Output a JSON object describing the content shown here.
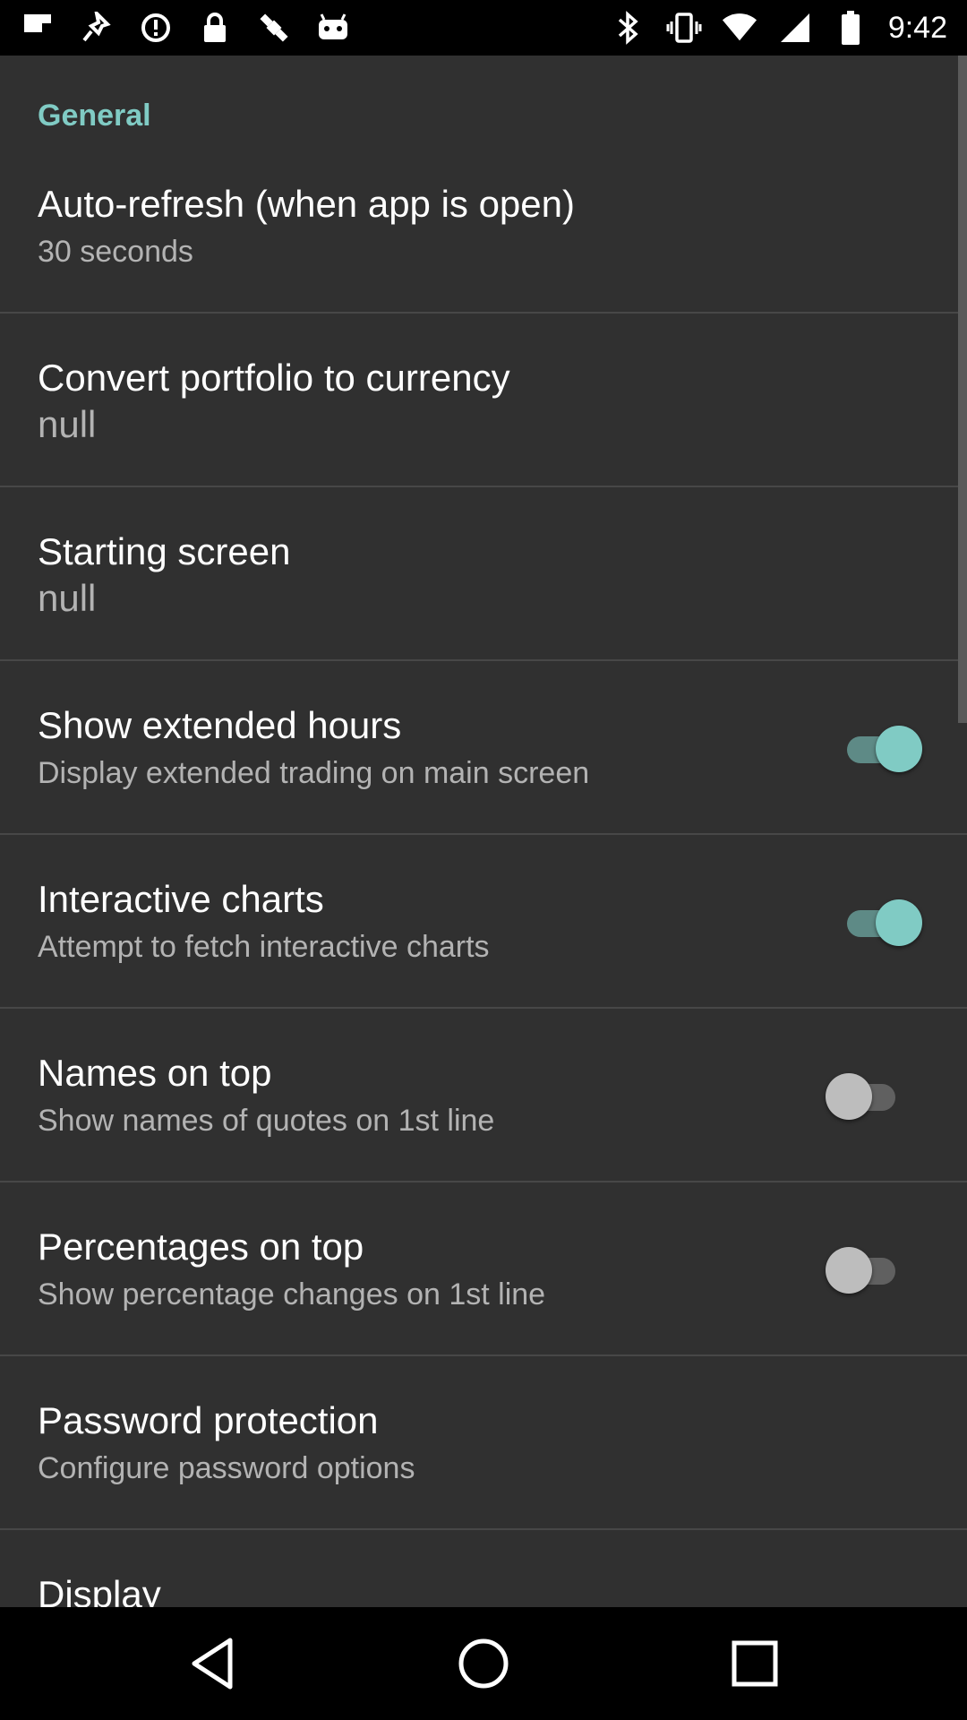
{
  "status_bar": {
    "time": "9:42",
    "left_icons": [
      "flipboard-icon",
      "pin-icon",
      "alert-icon",
      "lock-icon",
      "fake-gps-icon",
      "android-icon"
    ],
    "right_icons": [
      "bluetooth-icon",
      "vibrate-icon",
      "wifi-icon",
      "signal-icon",
      "battery-icon"
    ]
  },
  "settings": {
    "section_title": "General",
    "items": [
      {
        "title": "Auto-refresh (when app is open)",
        "summary": "30 seconds"
      },
      {
        "title": "Convert portfolio to currency",
        "summary": "null"
      },
      {
        "title": "Starting screen",
        "summary": "null"
      },
      {
        "title": "Show extended hours",
        "summary": "Display extended trading on main screen",
        "toggle": "on"
      },
      {
        "title": "Interactive charts",
        "summary": "Attempt to fetch interactive charts",
        "toggle": "on"
      },
      {
        "title": "Names on top",
        "summary": "Show names of quotes on 1st line",
        "toggle": "off"
      },
      {
        "title": "Percentages on top",
        "summary": "Show percentage changes on 1st line",
        "toggle": "off"
      },
      {
        "title": "Password protection",
        "summary": "Configure password options"
      },
      {
        "title": "Display"
      }
    ]
  },
  "nav_bar": {
    "buttons": [
      "back-icon",
      "home-icon",
      "recents-icon"
    ]
  },
  "colors": {
    "accent": "#80cbc4",
    "background": "#303030"
  }
}
